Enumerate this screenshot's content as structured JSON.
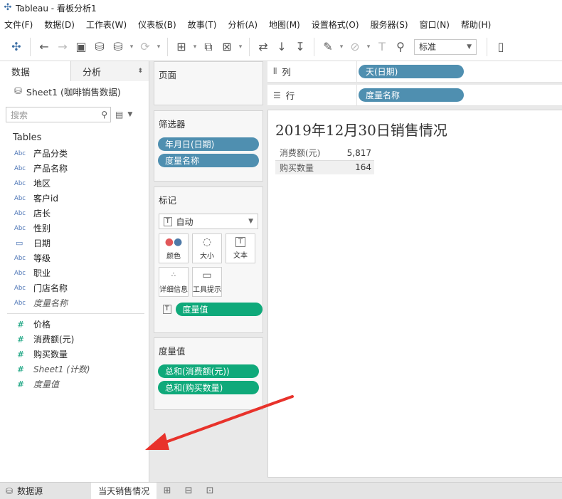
{
  "window": {
    "title": "Tableau - 看板分析1"
  },
  "menu": [
    "文件(F)",
    "数据(D)",
    "工作表(W)",
    "仪表板(B)",
    "故事(T)",
    "分析(A)",
    "地图(M)",
    "设置格式(O)",
    "服务器(S)",
    "窗口(N)",
    "帮助(H)"
  ],
  "toolbar": {
    "view_size": "标准"
  },
  "left_pane": {
    "tab_data": "数据",
    "tab_analysis": "分析",
    "datasource": "Sheet1 (咖啡销售数据)",
    "search_placeholder": "搜索",
    "tables_title": "Tables",
    "dimensions": [
      {
        "type": "Abc",
        "name": "产品分类"
      },
      {
        "type": "Abc",
        "name": "产品名称"
      },
      {
        "type": "Abc",
        "name": "地区"
      },
      {
        "type": "Abc",
        "name": "客户id"
      },
      {
        "type": "Abc",
        "name": "店长"
      },
      {
        "type": "Abc",
        "name": "性别"
      },
      {
        "type": "date",
        "name": "日期"
      },
      {
        "type": "Abc",
        "name": "等级"
      },
      {
        "type": "Abc",
        "name": "职业"
      },
      {
        "type": "Abc",
        "name": "门店名称"
      },
      {
        "type": "Abc",
        "name": "度量名称",
        "italic": true
      }
    ],
    "measures": [
      {
        "type": "#",
        "name": "价格"
      },
      {
        "type": "#",
        "name": "消费额(元)"
      },
      {
        "type": "#",
        "name": "购买数量"
      },
      {
        "type": "#",
        "name": "Sheet1 (计数)",
        "italic": true
      },
      {
        "type": "#",
        "name": "度量值",
        "italic": true
      }
    ]
  },
  "cards": {
    "pages_title": "页面",
    "filters_title": "筛选器",
    "filters": [
      "年月日(日期)",
      "度量名称"
    ],
    "marks_title": "标记",
    "marks_type": "自动",
    "mark_buttons": [
      "颜色",
      "大小",
      "文本",
      "详细信息",
      "工具提示"
    ],
    "marks_pill": "度量值",
    "measure_values_title": "度量值",
    "measure_values": [
      "总和(消费额(元))",
      "总和(购买数量)"
    ]
  },
  "shelves": {
    "columns_label": "列",
    "columns_pill": "天(日期)",
    "rows_label": "行",
    "rows_pill": "度量名称"
  },
  "view": {
    "title": "2019年12月30日销售情况",
    "rows": [
      {
        "label": "消费额(元)",
        "value": "5,817"
      },
      {
        "label": "购买数量",
        "value": "164"
      }
    ]
  },
  "statusbar": {
    "datasource_tab": "数据源",
    "sheet_tab": "当天销售情况"
  },
  "colors": {
    "dimension_pill": "#4f8fb0",
    "measure_pill": "#0fa97a",
    "annotation_arrow": "#e8322b"
  }
}
